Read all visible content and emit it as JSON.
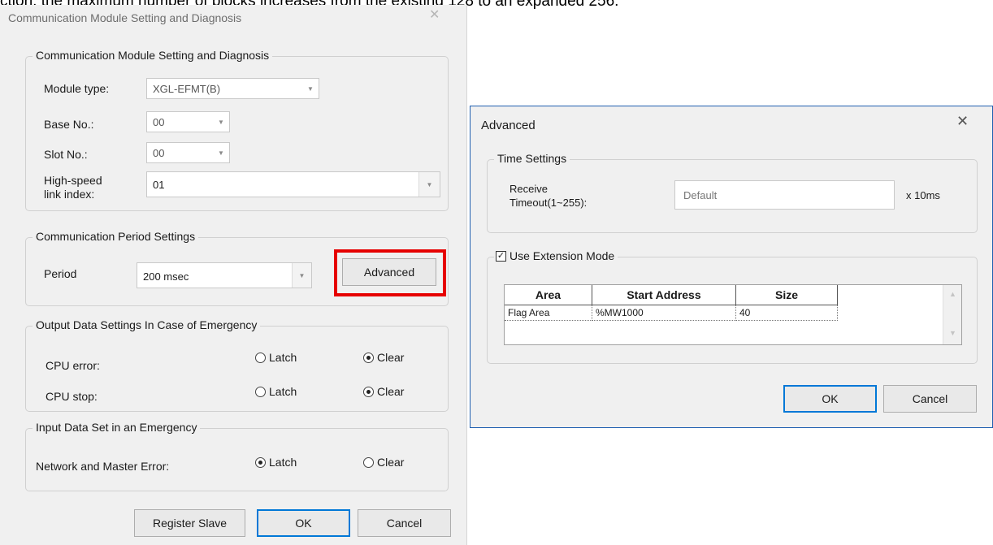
{
  "caption": "ction, the maximum number of blocks increases from the existing 128 to an expanded 256.",
  "left_dialog": {
    "title": "Communication Module Setting and Diagnosis",
    "close_glyph": "✕",
    "setting_group": {
      "legend": "Communication Module Setting and Diagnosis",
      "module_type_label": "Module type:",
      "module_type_value": "XGL-EFMT(B)",
      "base_no_label": "Base No.:",
      "base_no_value": "00",
      "slot_no_label": "Slot No.:",
      "slot_no_value": "00",
      "high_speed_label_1": "High-speed",
      "high_speed_label_2": "link index:",
      "high_speed_value": "01"
    },
    "period_group": {
      "legend": "Communication Period Settings",
      "period_label": "Period",
      "period_value": "200 msec",
      "advanced_button": "Advanced"
    },
    "output_group": {
      "legend": "Output Data Settings In Case of Emergency",
      "cpu_error_label": "CPU error:",
      "cpu_stop_label": "CPU stop:",
      "latch_label": "Latch",
      "clear_label": "Clear",
      "cpu_error_selected": "Clear",
      "cpu_stop_selected": "Clear"
    },
    "input_group": {
      "legend": "Input Data Set in an Emergency",
      "network_label": "Network and Master Error:",
      "latch_label": "Latch",
      "clear_label": "Clear",
      "selected": "Latch"
    },
    "buttons": {
      "register_slave": "Register Slave",
      "ok": "OK",
      "cancel": "Cancel"
    }
  },
  "advanced_dialog": {
    "title": "Advanced",
    "close_glyph": "✕",
    "time_group": {
      "legend": "Time Settings",
      "receive_label_1": "Receive",
      "receive_label_2": "Timeout(1~255):",
      "receive_value": "Default",
      "unit": "x 10ms"
    },
    "extension": {
      "legend": "Use Extension Mode",
      "checked": true,
      "check_glyph": "✓",
      "columns": [
        "Area",
        "Start Address",
        "Size"
      ],
      "rows": [
        [
          "Flag Area",
          "%MW1000",
          "40"
        ]
      ]
    },
    "buttons": {
      "ok": "OK",
      "cancel": "Cancel"
    }
  },
  "colors": {
    "highlight": "#e60000",
    "dialog_border": "#1f5fb0",
    "focus": "#0078d7"
  }
}
